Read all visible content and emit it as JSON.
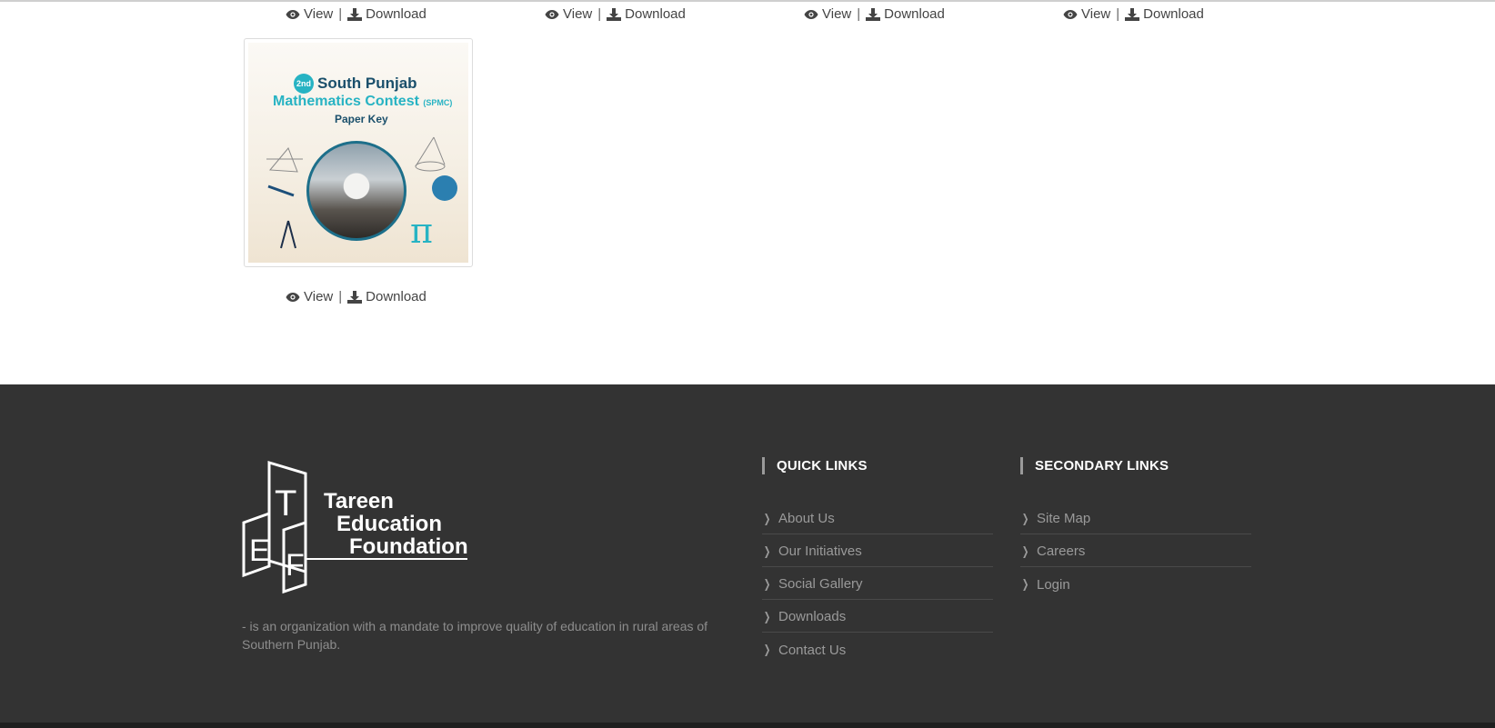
{
  "gallery": {
    "view_label": "View",
    "separator": "|",
    "download_label": "Download",
    "document": {
      "badge": "2nd",
      "title_line1": "South Punjab",
      "title_line2": "Mathematics Contest",
      "title_abbr": "(SPMC)",
      "subtitle": "Paper Key",
      "pi_symbol": "π"
    }
  },
  "footer": {
    "logo_lines": [
      "Tareen",
      "Education",
      "Foundation"
    ],
    "logo_letters": [
      "E",
      "T",
      "F"
    ],
    "tagline": "- is an organization with a mandate to improve quality of education in rural areas of Southern Punjab.",
    "quick_links": {
      "title": "QUICK LINKS",
      "items": [
        "About Us",
        "Our Initiatives",
        "Social Gallery",
        "Downloads",
        "Contact Us"
      ]
    },
    "secondary_links": {
      "title": "SECONDARY LINKS",
      "items": [
        "Site Map",
        "Careers",
        "Login"
      ]
    }
  },
  "colors": {
    "footer_bg": "#333333",
    "link_text": "#9a9a9a",
    "accent_teal": "#27b3c3"
  },
  "icons": {
    "view": "eye-icon",
    "download": "download-icon",
    "link_bullet": "chevron-right-icon"
  }
}
